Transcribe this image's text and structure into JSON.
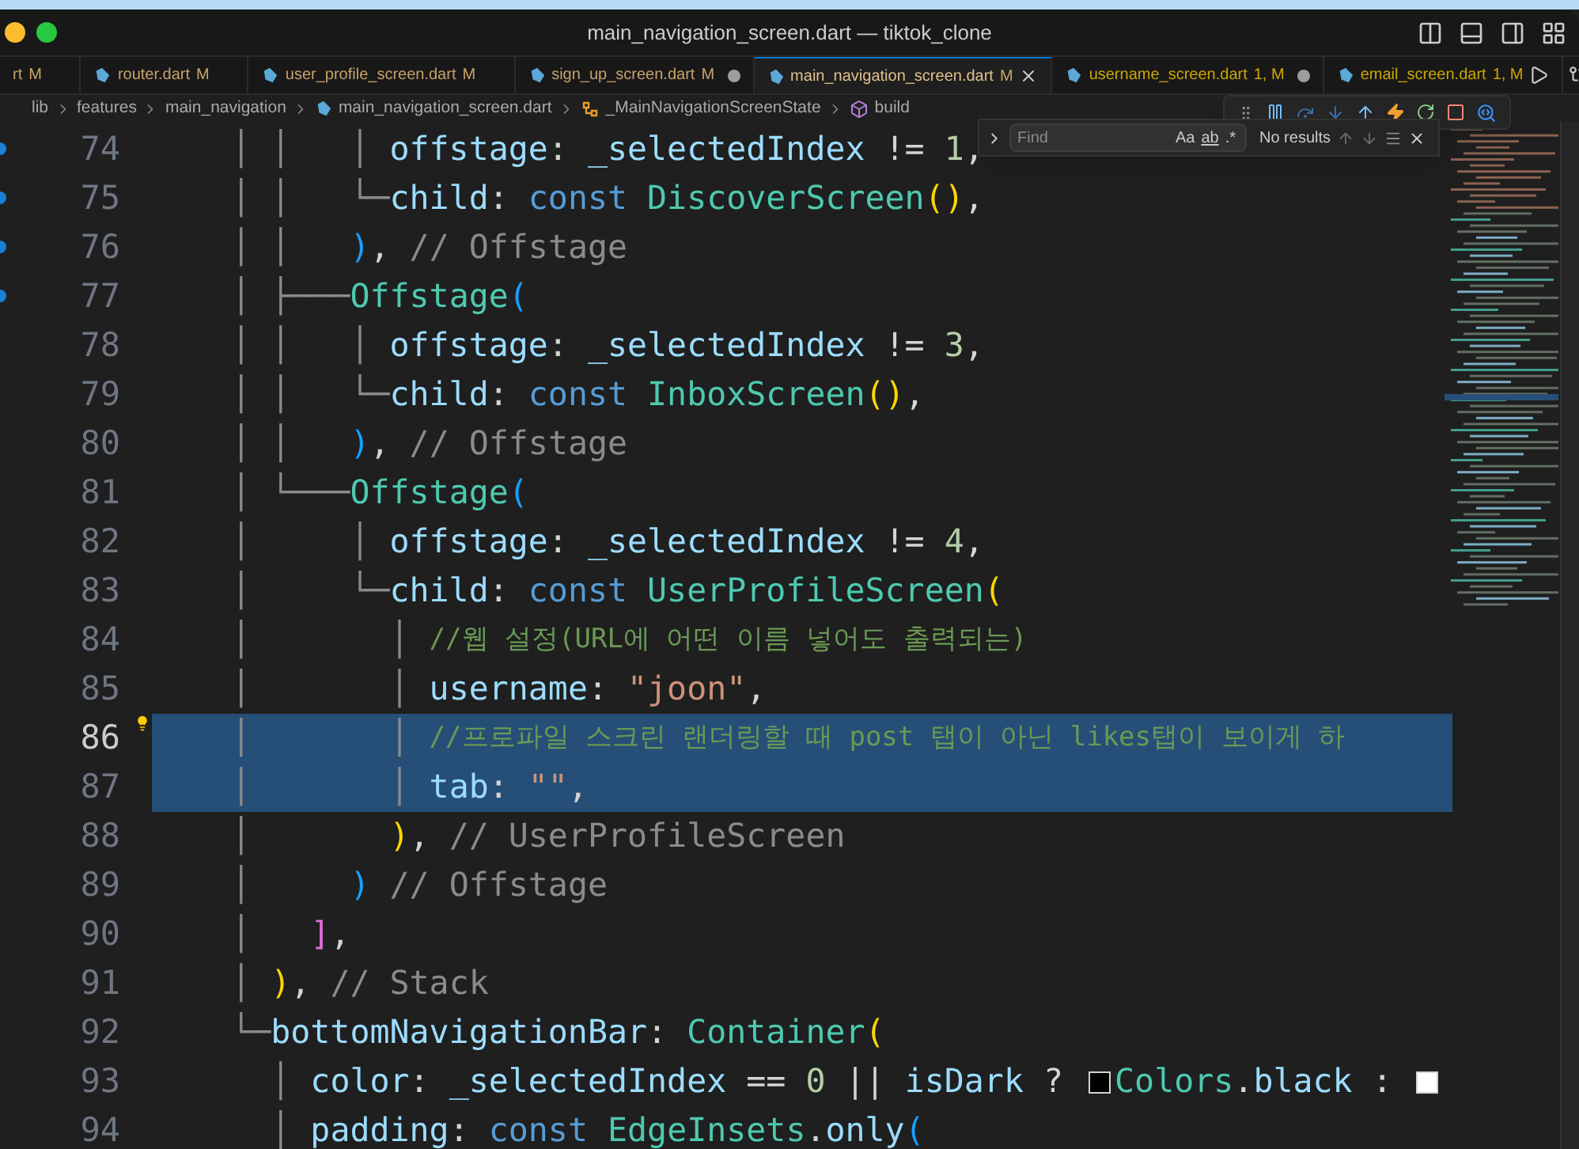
{
  "window": {
    "title": "main_navigation_screen.dart — tiktok_clone"
  },
  "tabs": [
    {
      "name": "rt",
      "status": "M",
      "kind": "modified",
      "dirty": false,
      "selected": false
    },
    {
      "name": "router.dart",
      "status": "M",
      "kind": "modified",
      "dirty": false,
      "selected": false
    },
    {
      "name": "user_profile_screen.dart",
      "status": "M",
      "kind": "modified",
      "dirty": false,
      "selected": false
    },
    {
      "name": "sign_up_screen.dart",
      "status": "M",
      "kind": "modified",
      "dirty": true,
      "selected": false
    },
    {
      "name": "main_navigation_screen.dart",
      "status": "M",
      "kind": "modified",
      "dirty": false,
      "selected": true
    },
    {
      "name": "username_screen.dart",
      "status": "1, M",
      "kind": "warning",
      "dirty": true,
      "selected": false
    },
    {
      "name": "email_screen.dart",
      "status": "1, M",
      "kind": "warning",
      "dirty": false,
      "selected": false
    }
  ],
  "breadcrumb": [
    {
      "kind": "folder",
      "label": "lib"
    },
    {
      "kind": "folder",
      "label": "features"
    },
    {
      "kind": "folder",
      "label": "main_navigation"
    },
    {
      "kind": "file",
      "label": "main_navigation_screen.dart"
    },
    {
      "kind": "class",
      "label": "_MainNavigationScreenState"
    },
    {
      "kind": "method",
      "label": "build"
    }
  ],
  "find": {
    "placeholder": "Find",
    "case_label": "Aa",
    "word_label": "ab",
    "regex_label": ".*",
    "result": "No results"
  },
  "lines": [
    {
      "number": "74",
      "changed": true,
      "selected": false,
      "current": false,
      "lightbulb": false,
      "tokens": [
        {
          "kind": "guide",
          "text": "    │ │   │ "
        },
        {
          "kind": "prop",
          "text": "offstage"
        },
        {
          "kind": "punct",
          "text": ": "
        },
        {
          "kind": "prop",
          "text": "_selectedIndex"
        },
        {
          "kind": "punct",
          "text": " != "
        },
        {
          "kind": "number",
          "text": "1"
        },
        {
          "kind": "punct",
          "text": ","
        }
      ]
    },
    {
      "number": "75",
      "changed": true,
      "selected": false,
      "current": false,
      "lightbulb": false,
      "tokens": [
        {
          "kind": "guide",
          "text": "    │ │   └─"
        },
        {
          "kind": "prop",
          "text": "child"
        },
        {
          "kind": "punct",
          "text": ": "
        },
        {
          "kind": "keyword",
          "text": "const"
        },
        {
          "kind": "class",
          "text": " DiscoverScreen"
        },
        {
          "kind": "bracket1",
          "text": "()"
        },
        {
          "kind": "punct",
          "text": ","
        }
      ]
    },
    {
      "number": "76",
      "changed": true,
      "selected": false,
      "current": false,
      "lightbulb": false,
      "tokens": [
        {
          "kind": "guide",
          "text": "    │ │   "
        },
        {
          "kind": "bracket3",
          "text": ")"
        },
        {
          "kind": "punct",
          "text": ", "
        },
        {
          "kind": "label",
          "text": "// Offstage"
        }
      ]
    },
    {
      "number": "77",
      "changed": true,
      "selected": false,
      "current": false,
      "lightbulb": false,
      "tokens": [
        {
          "kind": "guide",
          "text": "    │ ├───"
        },
        {
          "kind": "class",
          "text": "Offstage"
        },
        {
          "kind": "bracket3",
          "text": "("
        }
      ]
    },
    {
      "number": "78",
      "changed": false,
      "selected": false,
      "current": false,
      "lightbulb": false,
      "tokens": [
        {
          "kind": "guide",
          "text": "    │ │   │ "
        },
        {
          "kind": "prop",
          "text": "offstage"
        },
        {
          "kind": "punct",
          "text": ": "
        },
        {
          "kind": "prop",
          "text": "_selectedIndex"
        },
        {
          "kind": "punct",
          "text": " != "
        },
        {
          "kind": "number",
          "text": "3"
        },
        {
          "kind": "punct",
          "text": ","
        }
      ]
    },
    {
      "number": "79",
      "changed": false,
      "selected": false,
      "current": false,
      "lightbulb": false,
      "tokens": [
        {
          "kind": "guide",
          "text": "    │ │   └─"
        },
        {
          "kind": "prop",
          "text": "child"
        },
        {
          "kind": "punct",
          "text": ": "
        },
        {
          "kind": "keyword",
          "text": "const"
        },
        {
          "kind": "class",
          "text": " InboxScreen"
        },
        {
          "kind": "bracket1",
          "text": "()"
        },
        {
          "kind": "punct",
          "text": ","
        }
      ]
    },
    {
      "number": "80",
      "changed": false,
      "selected": false,
      "current": false,
      "lightbulb": false,
      "tokens": [
        {
          "kind": "guide",
          "text": "    │ │   "
        },
        {
          "kind": "bracket3",
          "text": ")"
        },
        {
          "kind": "punct",
          "text": ", "
        },
        {
          "kind": "label",
          "text": "// Offstage"
        }
      ]
    },
    {
      "number": "81",
      "changed": false,
      "selected": false,
      "current": false,
      "lightbulb": false,
      "tokens": [
        {
          "kind": "guide",
          "text": "    │ └───"
        },
        {
          "kind": "class",
          "text": "Offstage"
        },
        {
          "kind": "bracket3",
          "text": "("
        }
      ]
    },
    {
      "number": "82",
      "changed": false,
      "selected": false,
      "current": false,
      "lightbulb": false,
      "tokens": [
        {
          "kind": "guide",
          "text": "    │     │ "
        },
        {
          "kind": "prop",
          "text": "offstage"
        },
        {
          "kind": "punct",
          "text": ": "
        },
        {
          "kind": "prop",
          "text": "_selectedIndex"
        },
        {
          "kind": "punct",
          "text": " != "
        },
        {
          "kind": "number",
          "text": "4"
        },
        {
          "kind": "punct",
          "text": ","
        }
      ]
    },
    {
      "number": "83",
      "changed": false,
      "selected": false,
      "current": false,
      "lightbulb": false,
      "tokens": [
        {
          "kind": "guide",
          "text": "    │     └─"
        },
        {
          "kind": "prop",
          "text": "child"
        },
        {
          "kind": "punct",
          "text": ": "
        },
        {
          "kind": "keyword",
          "text": "const"
        },
        {
          "kind": "class",
          "text": " UserProfileScreen"
        },
        {
          "kind": "bracket1",
          "text": "("
        }
      ]
    },
    {
      "number": "84",
      "changed": false,
      "selected": false,
      "current": false,
      "lightbulb": false,
      "tokens": [
        {
          "kind": "guide",
          "text": "    │       │ "
        },
        {
          "kind": "comment",
          "text": "//웹 설정(URL에 어떤 이름 넣어도 출력되는)"
        }
      ]
    },
    {
      "number": "85",
      "changed": false,
      "selected": false,
      "current": false,
      "lightbulb": false,
      "tokens": [
        {
          "kind": "guide",
          "text": "    │       │ "
        },
        {
          "kind": "prop",
          "text": "username"
        },
        {
          "kind": "punct",
          "text": ": "
        },
        {
          "kind": "string",
          "text": "\"joon\""
        },
        {
          "kind": "punct",
          "text": ","
        }
      ]
    },
    {
      "number": "86",
      "changed": false,
      "selected": true,
      "current": true,
      "lightbulb": true,
      "tokens": [
        {
          "kind": "guide",
          "text": "    │       │ "
        },
        {
          "kind": "comment",
          "text": "//프로파일 스크린 랜더링할 때 post 탭이 아닌 likes탭이 보이게 하"
        }
      ]
    },
    {
      "number": "87",
      "changed": false,
      "selected": true,
      "current": false,
      "lightbulb": false,
      "tokens": [
        {
          "kind": "guide",
          "text": "    │       │ "
        },
        {
          "kind": "prop",
          "text": "tab"
        },
        {
          "kind": "punct",
          "text": ": "
        },
        {
          "kind": "string",
          "text": "\"\""
        },
        {
          "kind": "punct",
          "text": ","
        }
      ]
    },
    {
      "number": "88",
      "changed": false,
      "selected": false,
      "current": false,
      "lightbulb": false,
      "tokens": [
        {
          "kind": "guide",
          "text": "    │       "
        },
        {
          "kind": "bracket1",
          "text": ")"
        },
        {
          "kind": "punct",
          "text": ", "
        },
        {
          "kind": "label",
          "text": "// UserProfileScreen"
        }
      ]
    },
    {
      "number": "89",
      "changed": false,
      "selected": false,
      "current": false,
      "lightbulb": false,
      "tokens": [
        {
          "kind": "guide",
          "text": "    │     "
        },
        {
          "kind": "bracket3",
          "text": ")"
        },
        {
          "kind": "label",
          "text": " // Offstage"
        }
      ]
    },
    {
      "number": "90",
      "changed": false,
      "selected": false,
      "current": false,
      "lightbulb": false,
      "tokens": [
        {
          "kind": "guide",
          "text": "    │   "
        },
        {
          "kind": "bracket2",
          "text": "]"
        },
        {
          "kind": "punct",
          "text": ","
        }
      ]
    },
    {
      "number": "91",
      "changed": false,
      "selected": false,
      "current": false,
      "lightbulb": false,
      "tokens": [
        {
          "kind": "guide",
          "text": "    │ "
        },
        {
          "kind": "bracket1",
          "text": ")"
        },
        {
          "kind": "punct",
          "text": ", "
        },
        {
          "kind": "label",
          "text": "// Stack"
        }
      ]
    },
    {
      "number": "92",
      "changed": false,
      "selected": false,
      "current": false,
      "lightbulb": false,
      "tokens": [
        {
          "kind": "guide",
          "text": "    └─"
        },
        {
          "kind": "prop",
          "text": "bottomNavigationBar"
        },
        {
          "kind": "punct",
          "text": ": "
        },
        {
          "kind": "class",
          "text": "Container"
        },
        {
          "kind": "bracket1",
          "text": "("
        }
      ]
    },
    {
      "number": "93",
      "changed": false,
      "selected": false,
      "current": false,
      "lightbulb": false,
      "tokens": [
        {
          "kind": "guide",
          "text": "      │ "
        },
        {
          "kind": "prop",
          "text": "color"
        },
        {
          "kind": "punct",
          "text": ": "
        },
        {
          "kind": "prop",
          "text": "_selectedIndex"
        },
        {
          "kind": "punct",
          "text": " == "
        },
        {
          "kind": "number",
          "text": "0"
        },
        {
          "kind": "punct",
          "text": " || "
        },
        {
          "kind": "prop",
          "text": "isDark"
        },
        {
          "kind": "punct",
          "text": " ? "
        },
        {
          "kind": "swatch",
          "color": "#000000"
        },
        {
          "kind": "class",
          "text": "Colors"
        },
        {
          "kind": "punct",
          "text": "."
        },
        {
          "kind": "prop",
          "text": "black"
        },
        {
          "kind": "punct",
          "text": " : "
        },
        {
          "kind": "swatch",
          "color": "#ffffff"
        }
      ]
    },
    {
      "number": "94",
      "changed": false,
      "selected": false,
      "current": false,
      "lightbulb": false,
      "tokens": [
        {
          "kind": "guide",
          "text": "      │ "
        },
        {
          "kind": "prop",
          "text": "padding"
        },
        {
          "kind": "punct",
          "text": ": "
        },
        {
          "kind": "keyword",
          "text": "const"
        },
        {
          "kind": "class",
          "text": " EdgeInsets"
        },
        {
          "kind": "punct",
          "text": "."
        },
        {
          "kind": "prop",
          "text": "only"
        },
        {
          "kind": "bracket3",
          "text": "("
        }
      ]
    }
  ]
}
